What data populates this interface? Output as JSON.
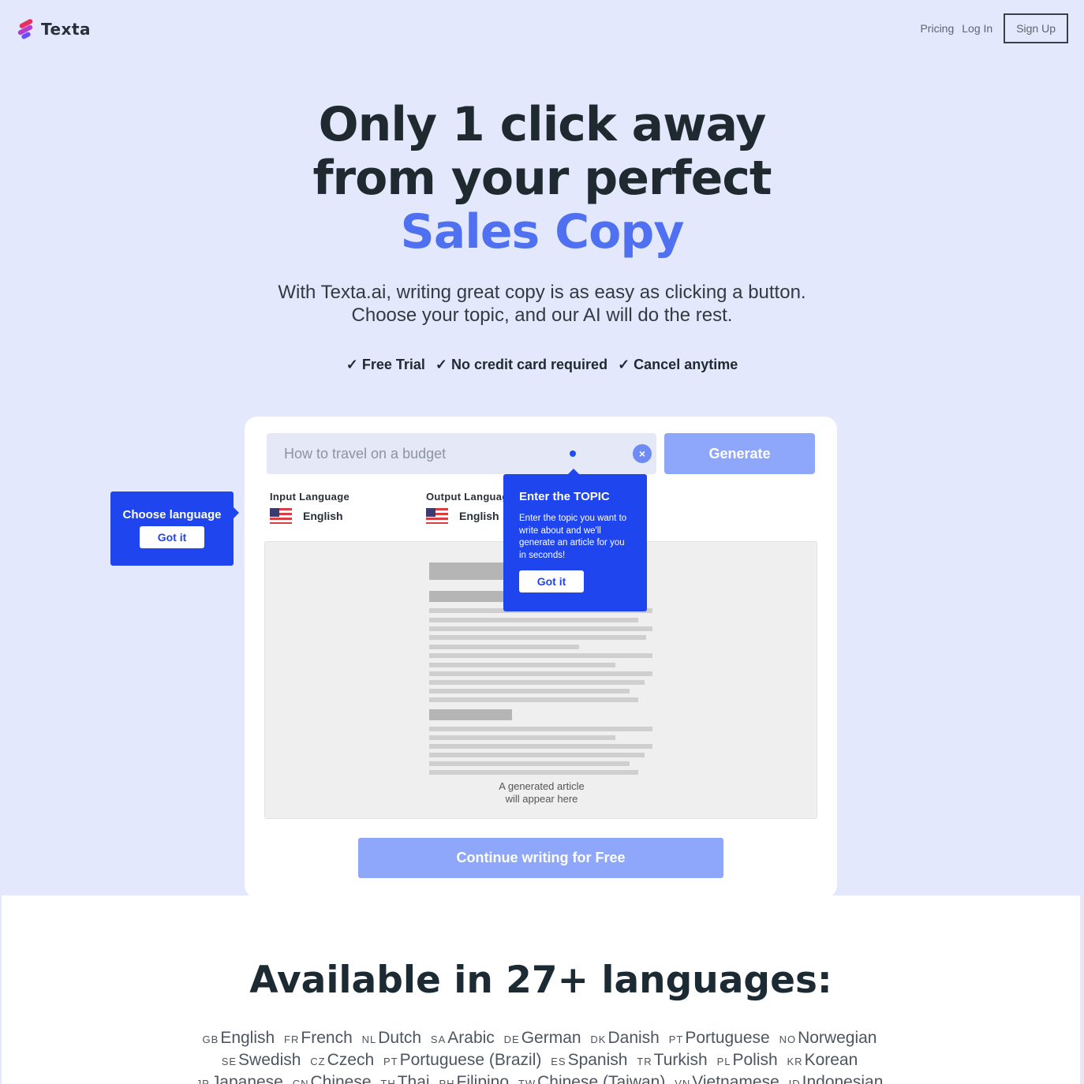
{
  "header": {
    "logo_text": "Texta",
    "nav": {
      "pricing": "Pricing",
      "login": "Log In",
      "signup": "Sign Up"
    }
  },
  "hero": {
    "headline_line1": "Only 1 click away",
    "headline_line2": "from your perfect",
    "headline_accent": "Sales Copy",
    "subline_line1": "With Texta.ai, writing great copy is as easy as clicking a button.",
    "subline_line2": "Choose your topic, and our AI will do the rest.",
    "perks": [
      "✓ Free Trial",
      "✓ No credit card required",
      "✓ Cancel anytime"
    ]
  },
  "demo": {
    "topic_placeholder": "How to travel on a budget",
    "clear_icon": "×",
    "generate_label": "Generate",
    "input_language_label": "Input Language",
    "input_language_value": "English",
    "output_language_label": "Output Language",
    "output_language_value": "English",
    "preview_caption_line1": "A generated article",
    "preview_caption_line2": "will appear here",
    "continue_label": "Continue writing for Free"
  },
  "tooltips": {
    "language": {
      "title": "Choose language",
      "button": "Got it"
    },
    "topic": {
      "title": "Enter the TOPIC",
      "description": "Enter the topic you want to write about and we'll generate an article for you in seconds!",
      "button": "Got it"
    }
  },
  "languages": {
    "title": "Available in 27+ languages:",
    "items": [
      {
        "code": "GB",
        "name": "English"
      },
      {
        "code": "FR",
        "name": "French"
      },
      {
        "code": "NL",
        "name": "Dutch"
      },
      {
        "code": "SA",
        "name": "Arabic"
      },
      {
        "code": "DE",
        "name": "German"
      },
      {
        "code": "DK",
        "name": "Danish"
      },
      {
        "code": "PT",
        "name": "Portuguese"
      },
      {
        "code": "NO",
        "name": "Norwegian"
      },
      {
        "code": "SE",
        "name": "Swedish"
      },
      {
        "code": "CZ",
        "name": "Czech"
      },
      {
        "code": "PT",
        "name": "Portuguese (Brazil)"
      },
      {
        "code": "ES",
        "name": "Spanish"
      },
      {
        "code": "TR",
        "name": "Turkish"
      },
      {
        "code": "PL",
        "name": "Polish"
      },
      {
        "code": "KR",
        "name": "Korean"
      },
      {
        "code": "JP",
        "name": "Japanese"
      },
      {
        "code": "CN",
        "name": "Chinese"
      },
      {
        "code": "TH",
        "name": "Thai"
      },
      {
        "code": "PH",
        "name": "Filipino"
      },
      {
        "code": "TW",
        "name": "Chinese (Taiwan)"
      },
      {
        "code": "VN",
        "name": "Vietnamese"
      },
      {
        "code": "ID",
        "name": "Indonesian"
      }
    ]
  },
  "colors": {
    "background": "#e3e8fc",
    "accent": "#4f70f0",
    "tooltip": "#1f45ee",
    "button_disabled": "#8ea7fa"
  }
}
